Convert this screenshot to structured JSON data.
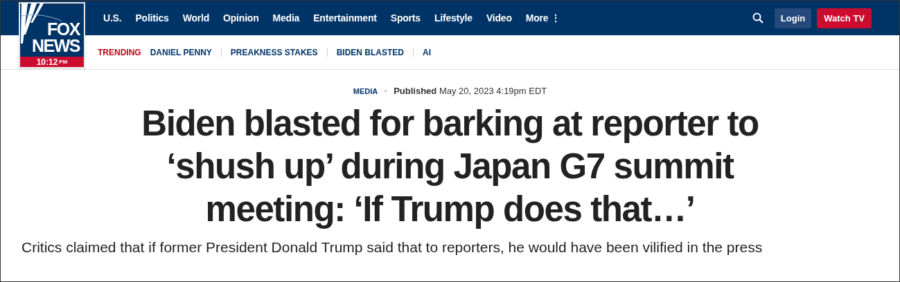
{
  "logo": {
    "brand_top": "FOX",
    "brand_bottom": "NEWS",
    "time": "10:12",
    "meridiem": "PM"
  },
  "nav": {
    "items": [
      "U.S.",
      "Politics",
      "World",
      "Opinion",
      "Media",
      "Entertainment",
      "Sports",
      "Lifestyle",
      "Video"
    ],
    "more": "More",
    "more_icon": "⋮",
    "login": "Login",
    "watch": "Watch TV"
  },
  "trending": {
    "label": "TRENDING",
    "items": [
      "DANIEL PENNY",
      "PREAKNESS STAKES",
      "BIDEN BLASTED",
      "AI"
    ]
  },
  "article": {
    "category": "MEDIA",
    "published_label": "Published",
    "published_date": "May 20, 2023 4:19pm EDT",
    "headline": "Biden blasted for barking at reporter to ‘shush up’ during Japan G7 summit meeting: ‘If Trump does that…’",
    "lead": "Critics claimed that if former President Donald Trump said that to reporters, he would have been vilified in the press"
  }
}
